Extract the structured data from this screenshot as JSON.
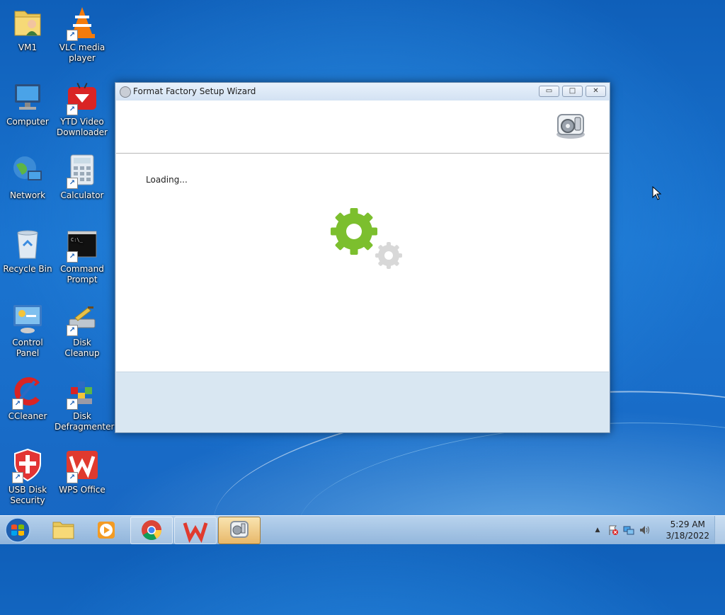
{
  "desktop": {
    "icons": [
      {
        "label": "VM1"
      },
      {
        "label": "VLC media player"
      },
      {
        "label": "Computer"
      },
      {
        "label": "YTD Video Downloader"
      },
      {
        "label": "Network"
      },
      {
        "label": "Calculator"
      },
      {
        "label": "Recycle Bin"
      },
      {
        "label": "Command Prompt"
      },
      {
        "label": "Control Panel"
      },
      {
        "label": "Disk Cleanup"
      },
      {
        "label": "CCleaner"
      },
      {
        "label": "Disk Defragmenter"
      },
      {
        "label": "USB Disk Security"
      },
      {
        "label": "WPS Office"
      }
    ]
  },
  "window": {
    "title": "Format Factory Setup Wizard",
    "status_text": "Loading...",
    "buttons": {
      "minimize": "▭",
      "maximize": "□",
      "close": "✕"
    },
    "gear_colors": {
      "primary": "#7cbf2e",
      "secondary": "#d8d8d8"
    }
  },
  "taskbar": {
    "items": [
      {
        "name": "windows-explorer"
      },
      {
        "name": "windows-media-player"
      },
      {
        "name": "google-chrome"
      },
      {
        "name": "wps-office"
      },
      {
        "name": "format-factory-setup",
        "active": true
      }
    ],
    "clock": {
      "time": "5:29 AM",
      "date": "3/18/2022"
    },
    "tray_icons": [
      "show-hidden-icons",
      "action-center-flag-icon",
      "network-icon",
      "volume-icon"
    ],
    "tray_arrow": "▲"
  }
}
